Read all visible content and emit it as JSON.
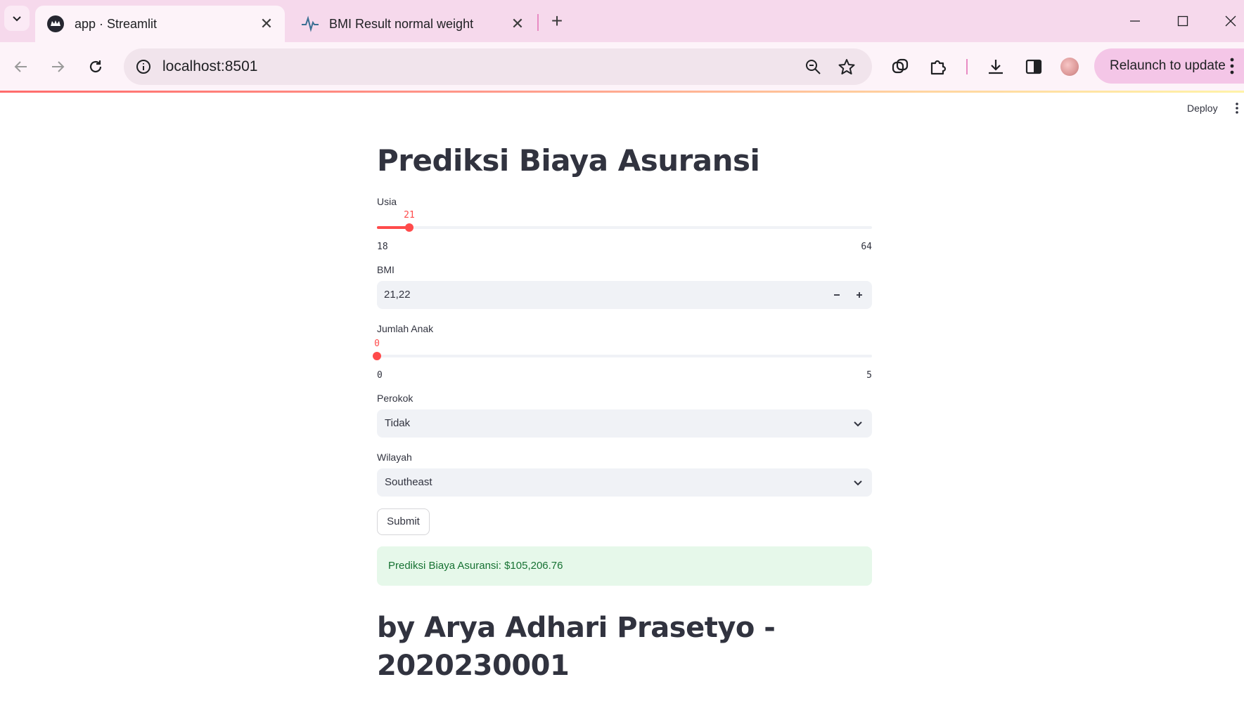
{
  "browser": {
    "tabs": [
      {
        "title": "app · Streamlit",
        "icon": "streamlit-crown-icon",
        "active": true
      },
      {
        "title": "BMI Result normal weight",
        "icon": "pulse-icon",
        "active": false
      }
    ],
    "url": "localhost:8501",
    "relaunch_label": "Relaunch to update"
  },
  "app": {
    "deploy_label": "Deploy",
    "title": "Prediksi Biaya Asuransi",
    "age": {
      "label": "Usia",
      "value": 21,
      "min": 18,
      "max": 64,
      "value_text": "21",
      "min_text": "18",
      "max_text": "64"
    },
    "bmi": {
      "label": "BMI",
      "value": "21,22"
    },
    "children": {
      "label": "Jumlah Anak",
      "value": 0,
      "min": 0,
      "max": 5,
      "value_text": "0",
      "min_text": "0",
      "max_text": "5"
    },
    "smoker": {
      "label": "Perokok",
      "selected": "Tidak"
    },
    "region": {
      "label": "Wilayah",
      "selected": "Southeast"
    },
    "submit_label": "Submit",
    "result": "Prediksi Biaya Asuransi: $105,206.76",
    "author": "by Arya Adhari Prasetyo - 2020230001"
  },
  "colors": {
    "accent": "#ff4b4b",
    "success_bg": "#e6f8ea",
    "success_text": "#177233",
    "tabbar": "#f6d9ec"
  }
}
